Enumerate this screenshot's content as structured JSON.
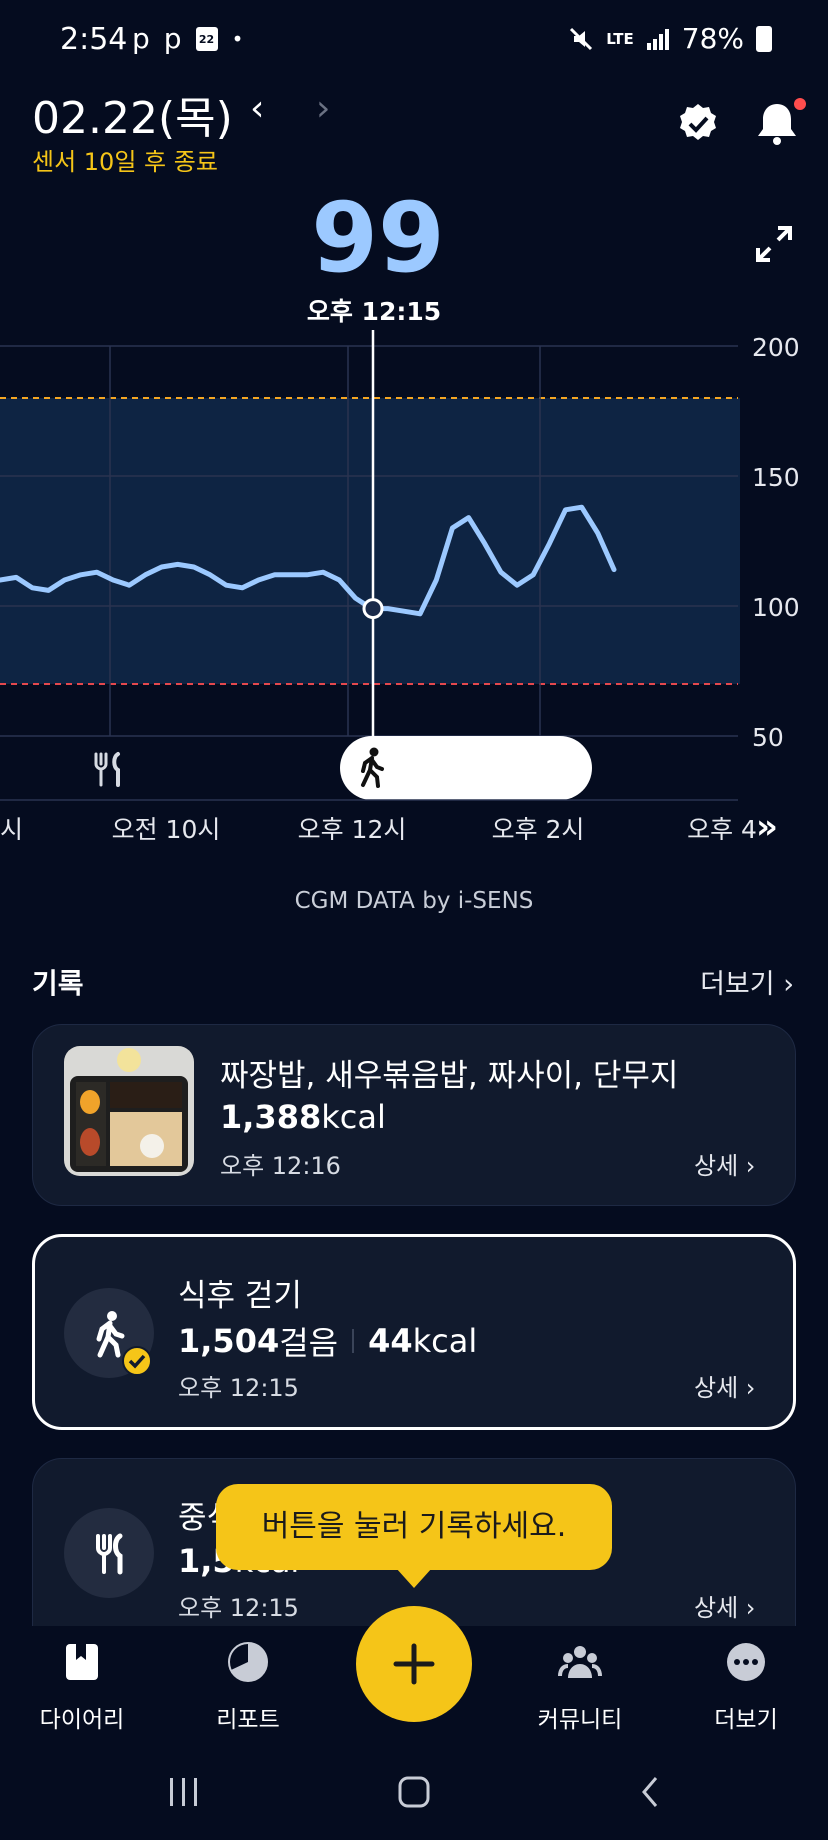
{
  "status_bar": {
    "time": "2:54",
    "left_icons": [
      "p",
      "p"
    ],
    "calendar_day": "22",
    "dot": "•",
    "network": "LTE",
    "battery": "78%"
  },
  "header": {
    "date": "02.22(목)",
    "prev": "‹",
    "next": "›",
    "sensor_notice": "센서 10일 후 종료"
  },
  "current": {
    "value": "99",
    "time": "오후 12:15"
  },
  "chart_data": {
    "type": "line",
    "ylim": [
      50,
      200
    ],
    "yticks": [
      "200",
      "150",
      "100",
      "50"
    ],
    "target_range": [
      70,
      180
    ],
    "xticks": [
      "시",
      "오전 10시",
      "오후 12시",
      "오후 2시",
      "오후 4"
    ],
    "selected_value": 99,
    "series": [
      {
        "values": [
          110,
          111,
          107,
          106,
          110,
          112,
          113,
          110,
          108,
          112,
          115,
          116,
          115,
          112,
          108,
          107,
          110,
          112,
          112,
          112,
          113,
          110,
          103,
          99,
          99,
          98,
          97,
          110,
          130,
          134,
          124,
          113,
          108,
          112,
          124,
          137,
          138,
          128,
          114
        ]
      }
    ]
  },
  "chart_events": {
    "walk_label": ""
  },
  "footer_note": "CGM DATA by i-SENS",
  "records": {
    "title": "기록",
    "more": "더보기 ›",
    "items": [
      {
        "title": "짜장밥, 새우볶음밥, 짜사이, 단무지",
        "kcal_value": "1,388",
        "kcal_unit": "kcal",
        "time": "오후 12:16",
        "detail": "상세 ›"
      },
      {
        "title": "식후 걷기",
        "steps_value": "1,504",
        "steps_unit": "걸음",
        "kcal_value": "44",
        "kcal_unit": "kcal",
        "time": "오후 12:15",
        "detail": "상세 ›"
      },
      {
        "title": "중식",
        "kcal_partial": "1,5",
        "kcal_suffix": "kcal",
        "time": "오후 12:15",
        "detail": "상세 ›"
      }
    ]
  },
  "tooltip": "버튼을 눌러 기록하세요.",
  "bottom_nav": {
    "items": [
      {
        "label": "다이어리",
        "icon": "diary-icon"
      },
      {
        "label": "리포트",
        "icon": "report-icon"
      },
      {
        "label": "커뮤니티",
        "icon": "community-icon"
      },
      {
        "label": "더보기",
        "icon": "more-icon"
      }
    ],
    "fab": "+"
  },
  "colors": {
    "accent": "#f5c518",
    "glucose_line": "#9cc9ff",
    "background": "#050c1f"
  }
}
